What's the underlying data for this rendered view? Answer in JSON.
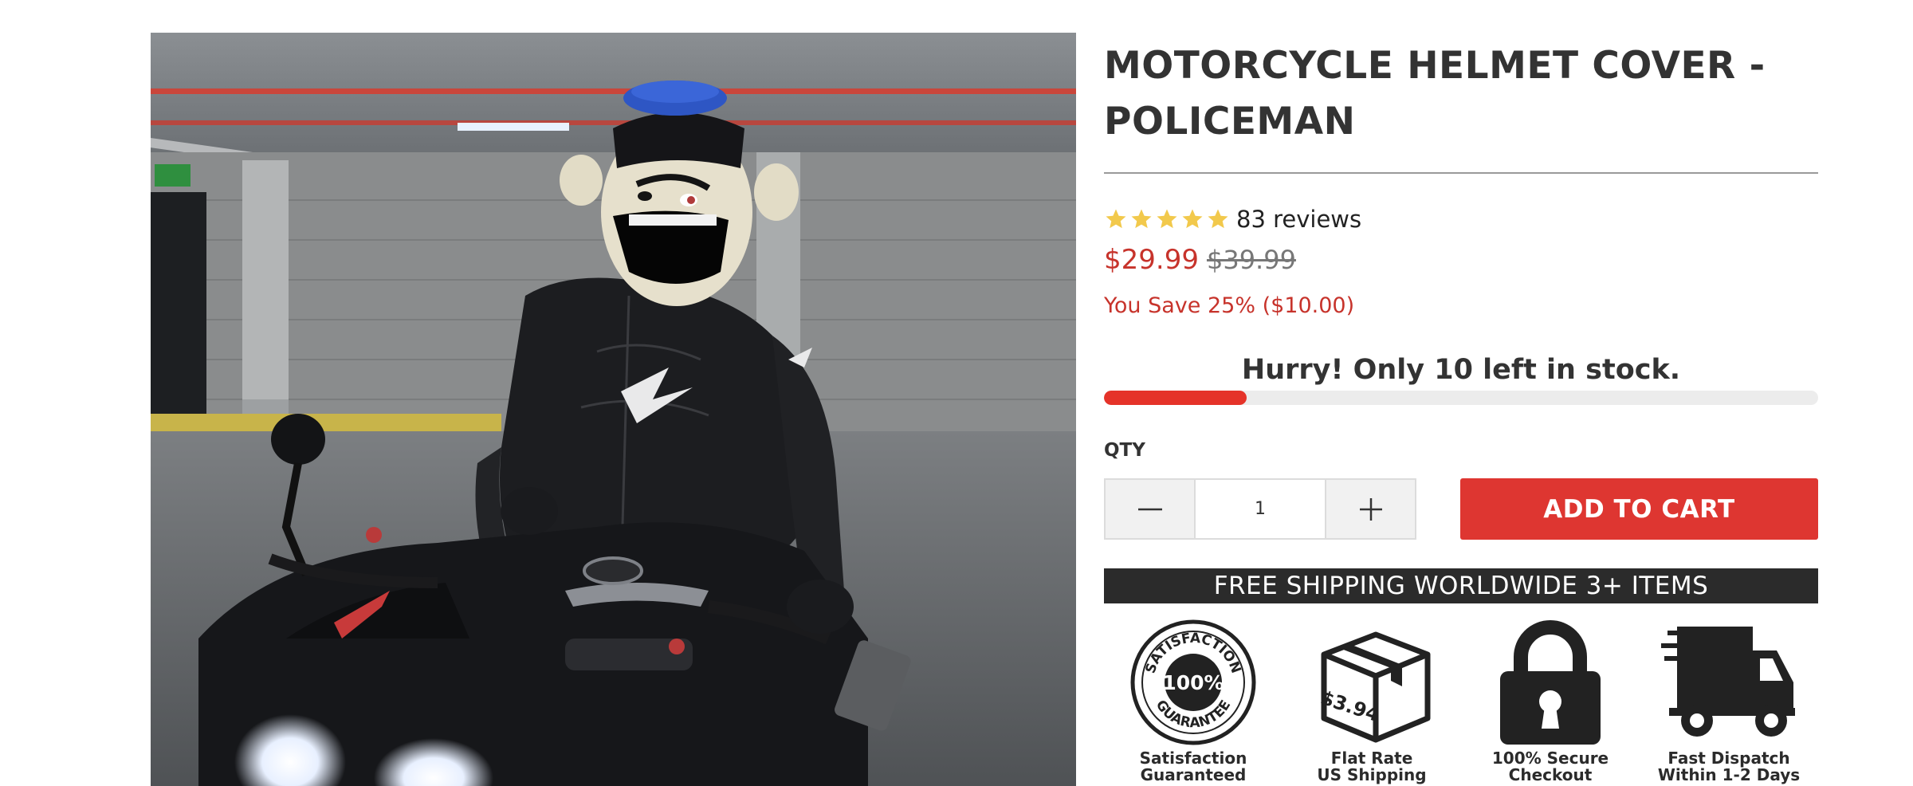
{
  "product": {
    "title": "MOTORCYCLE HELMET COVER - POLICEMAN",
    "image_alt": "Rider on motorcycle wearing policeman helmet cover",
    "rating": 5,
    "reviews_text": "83 reviews",
    "price_current": "$29.99",
    "price_original": "$39.99",
    "savings_text": "You Save 25% ($10.00)"
  },
  "stock": {
    "message": "Hurry! Only 10 left in stock.",
    "level_percent": 20
  },
  "quantity": {
    "label": "QTY",
    "value": "1"
  },
  "cart": {
    "add_label": "ADD TO CART"
  },
  "shipping_banner": "FREE SHIPPING WORLDWIDE 3+ ITEMS",
  "badges": [
    {
      "icon": "satisfaction-seal-icon",
      "line1": "Satisfaction",
      "line2": "Guaranteed",
      "seal_top": "SATISFACTION",
      "seal_mid": "100%",
      "seal_bottom": "GUARANTEE"
    },
    {
      "icon": "shipping-box-icon",
      "line1": "Flat Rate",
      "line2": "US Shipping",
      "box_price": "$3.94"
    },
    {
      "icon": "padlock-icon",
      "line1": "100% Secure",
      "line2": "Checkout"
    },
    {
      "icon": "delivery-truck-icon",
      "line1": "Fast Dispatch",
      "line2": "Within 1-2 Days"
    }
  ],
  "colors": {
    "accent_red": "#de3631",
    "price_red": "#c7332b",
    "star_yellow": "#f2c94c",
    "dark": "#2b2b2b"
  }
}
